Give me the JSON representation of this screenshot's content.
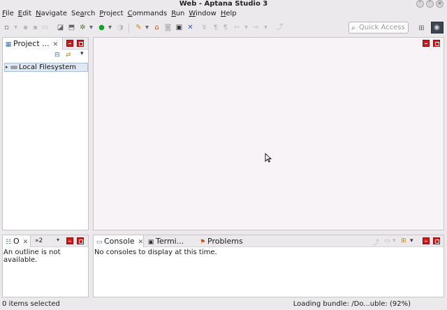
{
  "window": {
    "title": "Web - Aptana Studio 3"
  },
  "menu": [
    {
      "pre": "",
      "u": "F",
      "post": "ile"
    },
    {
      "pre": "",
      "u": "E",
      "post": "dit"
    },
    {
      "pre": "",
      "u": "N",
      "post": "avigate"
    },
    {
      "pre": "Se",
      "u": "a",
      "post": "rch"
    },
    {
      "pre": "",
      "u": "P",
      "post": "roject"
    },
    {
      "pre": "",
      "u": "C",
      "post": "ommands"
    },
    {
      "pre": "",
      "u": "R",
      "post": "un"
    },
    {
      "pre": "",
      "u": "W",
      "post": "indow"
    },
    {
      "pre": "",
      "u": "H",
      "post": "elp"
    }
  ],
  "toolbar": {
    "quick_access_placeholder": "Quick Access"
  },
  "project_panel": {
    "tab_label": "Project ...",
    "tree": [
      {
        "label": "Local Filesystem"
      }
    ]
  },
  "outline_panel": {
    "tab_label": "O",
    "second_tab_label": "»2",
    "message": "An outline is not available."
  },
  "console_panel": {
    "tabs": [
      {
        "label": "Console"
      },
      {
        "label": "Termi..."
      },
      {
        "label": "Problems"
      }
    ],
    "message": "No consoles to display at this time."
  },
  "status": {
    "left": "0 items selected",
    "right": "Loading bundle: /Do...uble: (92%)"
  },
  "colors": {
    "accent_red": "#d11a1a",
    "selection": "#dfe8f3"
  }
}
